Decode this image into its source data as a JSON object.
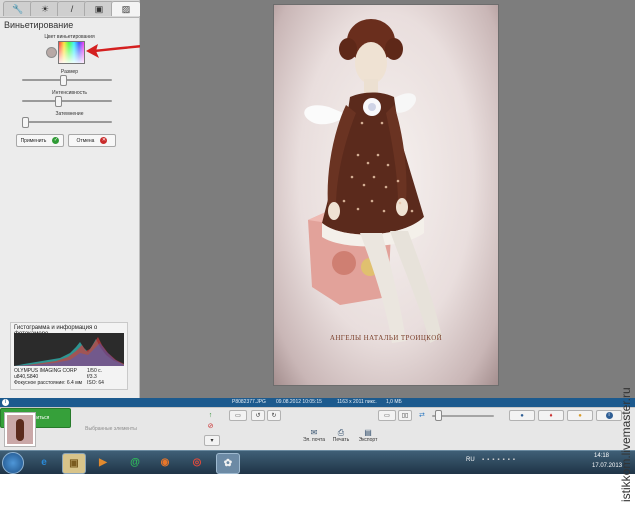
{
  "left_panel": {
    "tabs": [
      {
        "icon": "wrench-icon",
        "glyph": "🔧"
      },
      {
        "icon": "sun-icon",
        "glyph": "☀"
      },
      {
        "icon": "brush-icon",
        "glyph": "/"
      },
      {
        "icon": "picture-icon",
        "glyph": "▣"
      },
      {
        "icon": "effects-icon",
        "glyph": "▨"
      }
    ],
    "title": "Виньетирование",
    "color_label": "Цвет виньетирования",
    "sliders": [
      {
        "label": "Размер",
        "value": 0.45
      },
      {
        "label": "Интенсивность",
        "value": 0.4
      },
      {
        "label": "Затемнение",
        "value": 0.03
      }
    ],
    "apply_label": "Применить",
    "cancel_label": "Отмена",
    "histogram": {
      "title": "Гистограмма и информация о фотокамере",
      "camera": "OLYMPUS IMAGING CORP",
      "model": "u840,S840",
      "shutter": "1/50 с.",
      "aperture": "f/3.3",
      "focal": "Фокусное расстояние: 6.4 мм",
      "iso": "ISO: 64"
    }
  },
  "photo": {
    "caption": "АНГЕЛЫ НАТАЛЬИ ТРОИЦКОЙ"
  },
  "file_info": {
    "filename": "P8082377.JPG",
    "datetime": "09.08.2012 10:05:15",
    "dimensions": "1163 x 2011 пикс.",
    "size": "1,0 МБ"
  },
  "tray": {
    "selected_label": "Выбранные элементы",
    "share_label": "Поделиться",
    "email_label": "Эл. почта",
    "print_label": "Печать",
    "export_label": "Экспорт"
  },
  "taskbar": {
    "language": "RU",
    "time": "14:18",
    "date": "17.07.2013"
  },
  "watermark": "istikkom.livemaster.ru",
  "colors": {
    "arrow": "#d42020",
    "file_bar": "#1c5a8e",
    "share_button": "#36a03a",
    "viewer_bg": "#7d7d7d"
  }
}
